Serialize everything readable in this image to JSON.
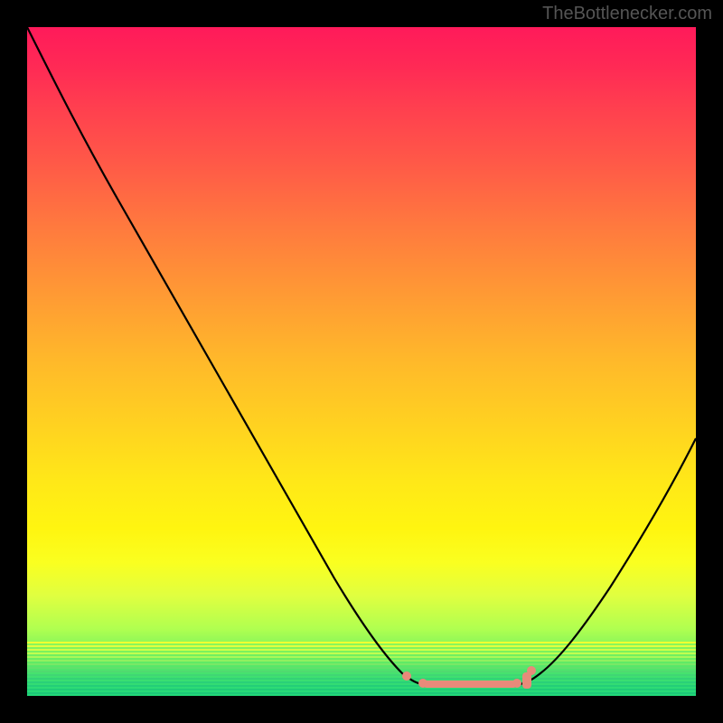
{
  "watermark": "TheBottlenecker.com",
  "chart_data": {
    "type": "line",
    "title": "",
    "xlabel": "",
    "ylabel": "",
    "xlim": [
      0,
      100
    ],
    "ylim": [
      0,
      100
    ],
    "x": [
      0,
      5,
      10,
      15,
      20,
      25,
      30,
      35,
      40,
      45,
      50,
      55,
      58,
      60,
      63,
      66,
      70,
      73,
      76,
      80,
      85,
      90,
      95,
      100
    ],
    "values": [
      100,
      92,
      84,
      76,
      68,
      59,
      51,
      42,
      34,
      25,
      17,
      9,
      5,
      3,
      2,
      2,
      2,
      3,
      5,
      9,
      17,
      26,
      36,
      46
    ],
    "marker_points": {
      "x": [
        58,
        60,
        63,
        66,
        70,
        73
      ],
      "y": [
        5,
        3,
        2,
        2,
        2,
        3
      ]
    },
    "background_gradient": {
      "top": "#ff1a5a",
      "mid": "#fff510",
      "bottom": "#20d878"
    },
    "curve_color": "#000000",
    "marker_color": "#e88a7a"
  }
}
